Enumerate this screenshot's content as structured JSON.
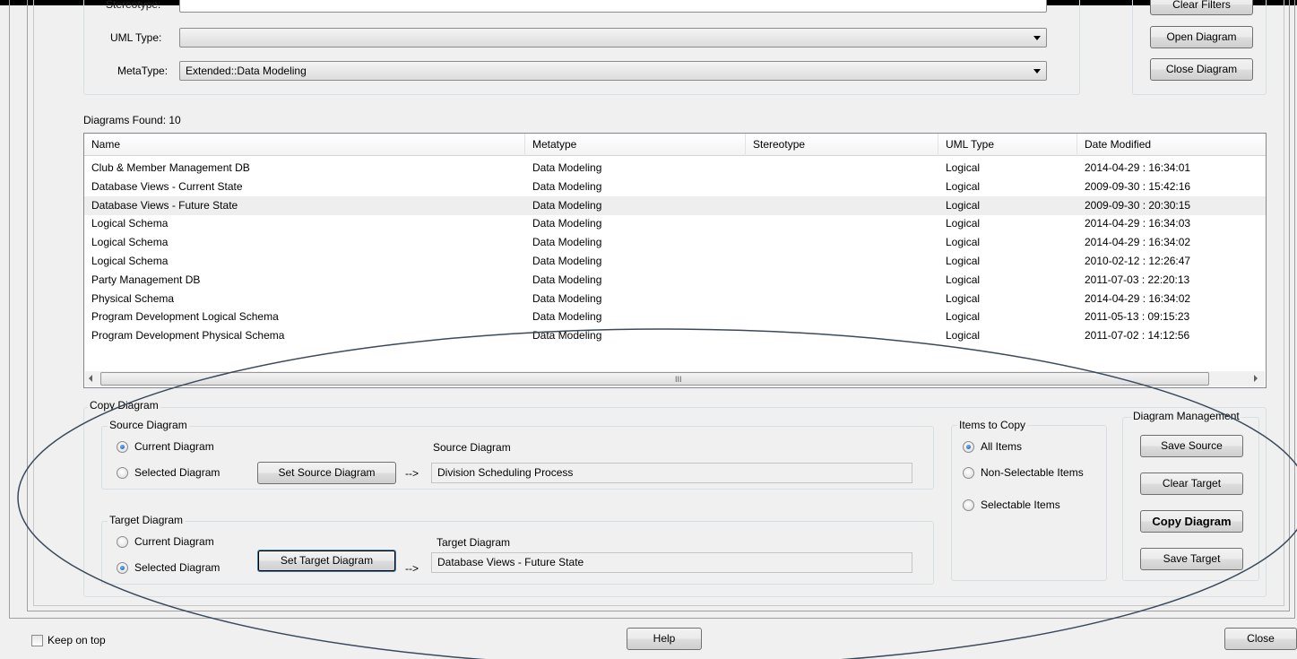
{
  "filters": {
    "stereotype_label": "Stereotype:",
    "stereotype_value": "",
    "uml_type_label": "UML Type:",
    "uml_type_value": "",
    "metatype_label": "MetaType:",
    "metatype_value": "Extended::Data Modeling"
  },
  "side_buttons": {
    "clear_filters": "Clear Filters",
    "open_diagram": "Open Diagram",
    "close_diagram": "Close Diagram"
  },
  "diagrams_found": "Diagrams Found: 10",
  "table": {
    "columns": [
      "Name",
      "Metatype",
      "Stereotype",
      "UML Type",
      "Date Modified"
    ],
    "rows": [
      [
        "Club & Member Management DB",
        "Data Modeling",
        "",
        "Logical",
        "2014-04-29 : 16:34:01"
      ],
      [
        "Database Views - Current State",
        "Data Modeling",
        "",
        "Logical",
        "2009-09-30 : 15:42:16"
      ],
      [
        "Database Views - Future State",
        "Data Modeling",
        "",
        "Logical",
        "2009-09-30 : 20:30:15"
      ],
      [
        "Logical Schema",
        "Data Modeling",
        "",
        "Logical",
        "2014-04-29 : 16:34:03"
      ],
      [
        "Logical Schema",
        "Data Modeling",
        "",
        "Logical",
        "2014-04-29 : 16:34:02"
      ],
      [
        "Logical Schema",
        "Data Modeling",
        "",
        "Logical",
        "2010-02-12 : 12:26:47"
      ],
      [
        "Party Management DB",
        "Data Modeling",
        "",
        "Logical",
        "2011-07-03 : 22:20:13"
      ],
      [
        "Physical Schema",
        "Data Modeling",
        "",
        "Logical",
        "2014-04-29 : 16:34:02"
      ],
      [
        "Program Development Logical Schema",
        "Data Modeling",
        "",
        "Logical",
        "2011-05-13 : 09:15:23"
      ],
      [
        "Program Development Physical Schema",
        "Data Modeling",
        "",
        "Logical",
        "2011-07-02 : 14:12:56"
      ]
    ],
    "selected_row": 2,
    "scroll_grip": "III"
  },
  "copy": {
    "title": "Copy Diagram",
    "source": {
      "title": "Source Diagram",
      "current": "Current Diagram",
      "selected": "Selected Diagram",
      "checked": "current",
      "set_button": "Set Source Diagram",
      "arrow": "-->",
      "field_label": "Source Diagram",
      "field_value": "Division Scheduling Process"
    },
    "target": {
      "title": "Target Diagram",
      "current": "Current Diagram",
      "selected": "Selected Diagram",
      "checked": "selected",
      "set_button": "Set Target Diagram",
      "arrow": "-->",
      "field_label": "Target Diagram",
      "field_value": "Database Views - Future State"
    },
    "items": {
      "title": "Items to Copy",
      "all": "All Items",
      "non_selectable": "Non-Selectable Items",
      "selectable": "Selectable Items",
      "checked": "all"
    },
    "management": {
      "title": "Diagram Management",
      "save_source": "Save Source",
      "clear_target": "Clear Target",
      "copy_diagram": "Copy Diagram",
      "save_target": "Save Target"
    }
  },
  "footer": {
    "keep_on_top": "Keep on top",
    "help": "Help",
    "close": "Close"
  },
  "annotation_color": "#3a4a5c"
}
